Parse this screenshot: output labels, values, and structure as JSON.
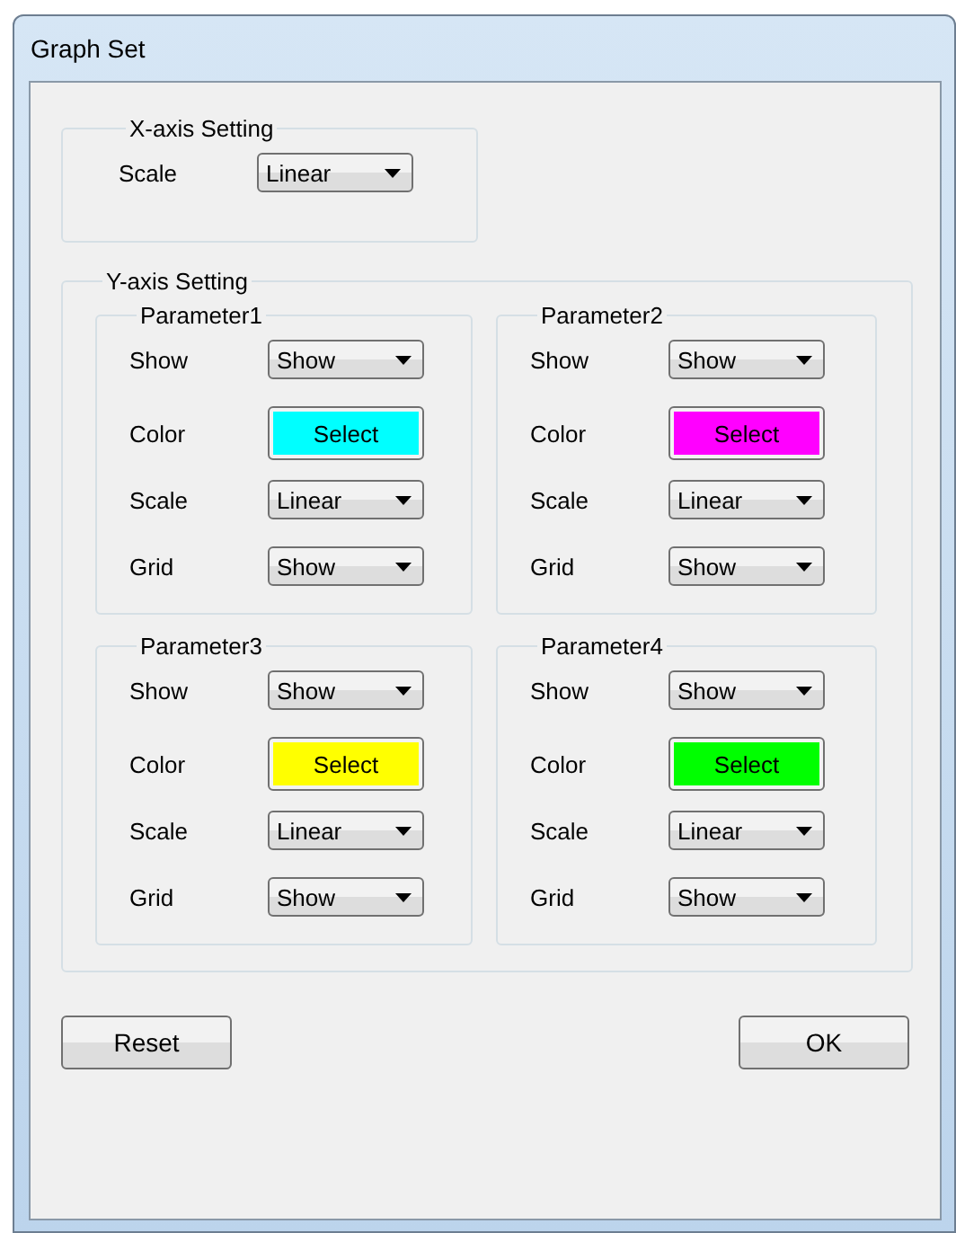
{
  "window": {
    "title": "Graph Set"
  },
  "x_axis": {
    "title": "X-axis Setting",
    "fields": [
      {
        "label": "Scale",
        "kind": "select",
        "value": "Linear"
      }
    ]
  },
  "y_axis": {
    "title": "Y-axis Setting",
    "parameters": [
      {
        "title": "Parameter1",
        "fields": [
          {
            "label": "Show",
            "kind": "select",
            "value": "Show"
          },
          {
            "label": "Color",
            "kind": "color",
            "value": "Select",
            "color": "#00ffff"
          },
          {
            "label": "Scale",
            "kind": "select",
            "value": "Linear"
          },
          {
            "label": "Grid",
            "kind": "select",
            "value": "Show"
          }
        ]
      },
      {
        "title": "Parameter2",
        "fields": [
          {
            "label": "Show",
            "kind": "select",
            "value": "Show"
          },
          {
            "label": "Color",
            "kind": "color",
            "value": "Select",
            "color": "#ff00ff"
          },
          {
            "label": "Scale",
            "kind": "select",
            "value": "Linear"
          },
          {
            "label": "Grid",
            "kind": "select",
            "value": "Show"
          }
        ]
      },
      {
        "title": "Parameter3",
        "fields": [
          {
            "label": "Show",
            "kind": "select",
            "value": "Show"
          },
          {
            "label": "Color",
            "kind": "color",
            "value": "Select",
            "color": "#ffff00"
          },
          {
            "label": "Scale",
            "kind": "select",
            "value": "Linear"
          },
          {
            "label": "Grid",
            "kind": "select",
            "value": "Show"
          }
        ]
      },
      {
        "title": "Parameter4",
        "fields": [
          {
            "label": "Show",
            "kind": "select",
            "value": "Show"
          },
          {
            "label": "Color",
            "kind": "color",
            "value": "Select",
            "color": "#00ff00"
          },
          {
            "label": "Scale",
            "kind": "select",
            "value": "Linear"
          },
          {
            "label": "Grid",
            "kind": "select",
            "value": "Show"
          }
        ]
      }
    ]
  },
  "buttons": [
    "Reset",
    "OK"
  ]
}
